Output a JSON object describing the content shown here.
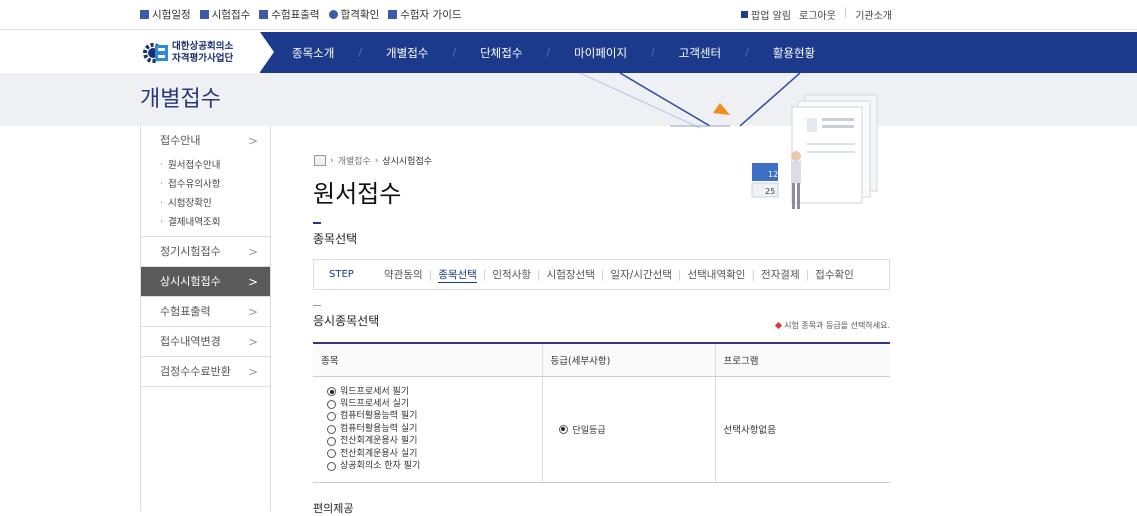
{
  "utility": {
    "left": [
      "시험일정",
      "시험접수",
      "수험표출력",
      "합격확인",
      "수험자 가이드"
    ],
    "right": [
      "팝업 알림",
      "로그아웃",
      "기관소개"
    ]
  },
  "logo": {
    "line1": "대한상공회의소",
    "line2": "자격평가사업단"
  },
  "gnb": [
    "종목소개",
    "개별접수",
    "단체접수",
    "마이페이지",
    "고객센터",
    "활용현황"
  ],
  "visual": {
    "title": "개별접수"
  },
  "lnb": {
    "group1": "접수안내",
    "group1_subs": [
      "원서접수안내",
      "접수유의사항",
      "시험장확인",
      "결제내역조회"
    ],
    "items": [
      "정기시험접수",
      "상시시험접수",
      "수험표출력",
      "접수내역변경",
      "검정수수료반환"
    ]
  },
  "breadcrumb": {
    "level1": "개별접수",
    "level2": "상시시험접수"
  },
  "page_title": "원서접수",
  "section_title": "종목선택",
  "steps": {
    "label": "STEP",
    "items": [
      "약관동의",
      "종목선택",
      "인적사항",
      "시험장선택",
      "일자/시간선택",
      "선택내역확인",
      "전자결제",
      "접수확인"
    ],
    "current": 1
  },
  "subsection_title": "응시종목선택",
  "hint": "시험 종목과 등급을 선택하세요.",
  "table": {
    "headers": [
      "종목",
      "등급(세부사항)",
      "프로그램"
    ],
    "subjects": [
      "워드프로세서 필기",
      "워드프로세서 실기",
      "컴퓨터활용능력 필기",
      "컴퓨터활용능력 실기",
      "전산회계운용사 필기",
      "전산회계운용사 실기",
      "상공회의소 한자 필기"
    ],
    "selected_subject": 0,
    "grade": "단일등급",
    "program": "선택사항없음"
  },
  "next_section_title": "편의제공",
  "calendar": {
    "top": "12",
    "bottom": "25"
  }
}
